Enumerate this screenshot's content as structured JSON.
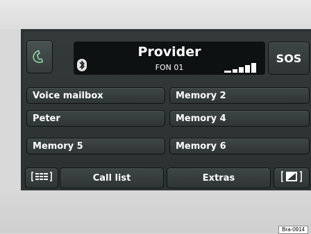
{
  "header": {
    "provider": "Provider",
    "line": "FON 01",
    "sos_label": "SOS",
    "call_icon": "phone-handset-icon",
    "bluetooth_icon": "bluetooth-icon",
    "signal_icon": "signal-strength-icon"
  },
  "buttons": [
    {
      "label": "Voice mailbox"
    },
    {
      "label": "Memory 2"
    },
    {
      "label": "Peter"
    },
    {
      "label": "Memory 4"
    },
    {
      "label": "Memory 5"
    },
    {
      "label": "Memory 6"
    }
  ],
  "bottom_bar": {
    "keypad_icon": "keypad-icon",
    "call_list": "Call list",
    "extras": "Extras",
    "end_icon": "phone-book-icon"
  },
  "figure_id": "Bra-0914",
  "colors": {
    "screen_bg": "#2d3232",
    "button_bg": "#394040",
    "header_bg": "#0e1111",
    "text": "#ffffff"
  }
}
